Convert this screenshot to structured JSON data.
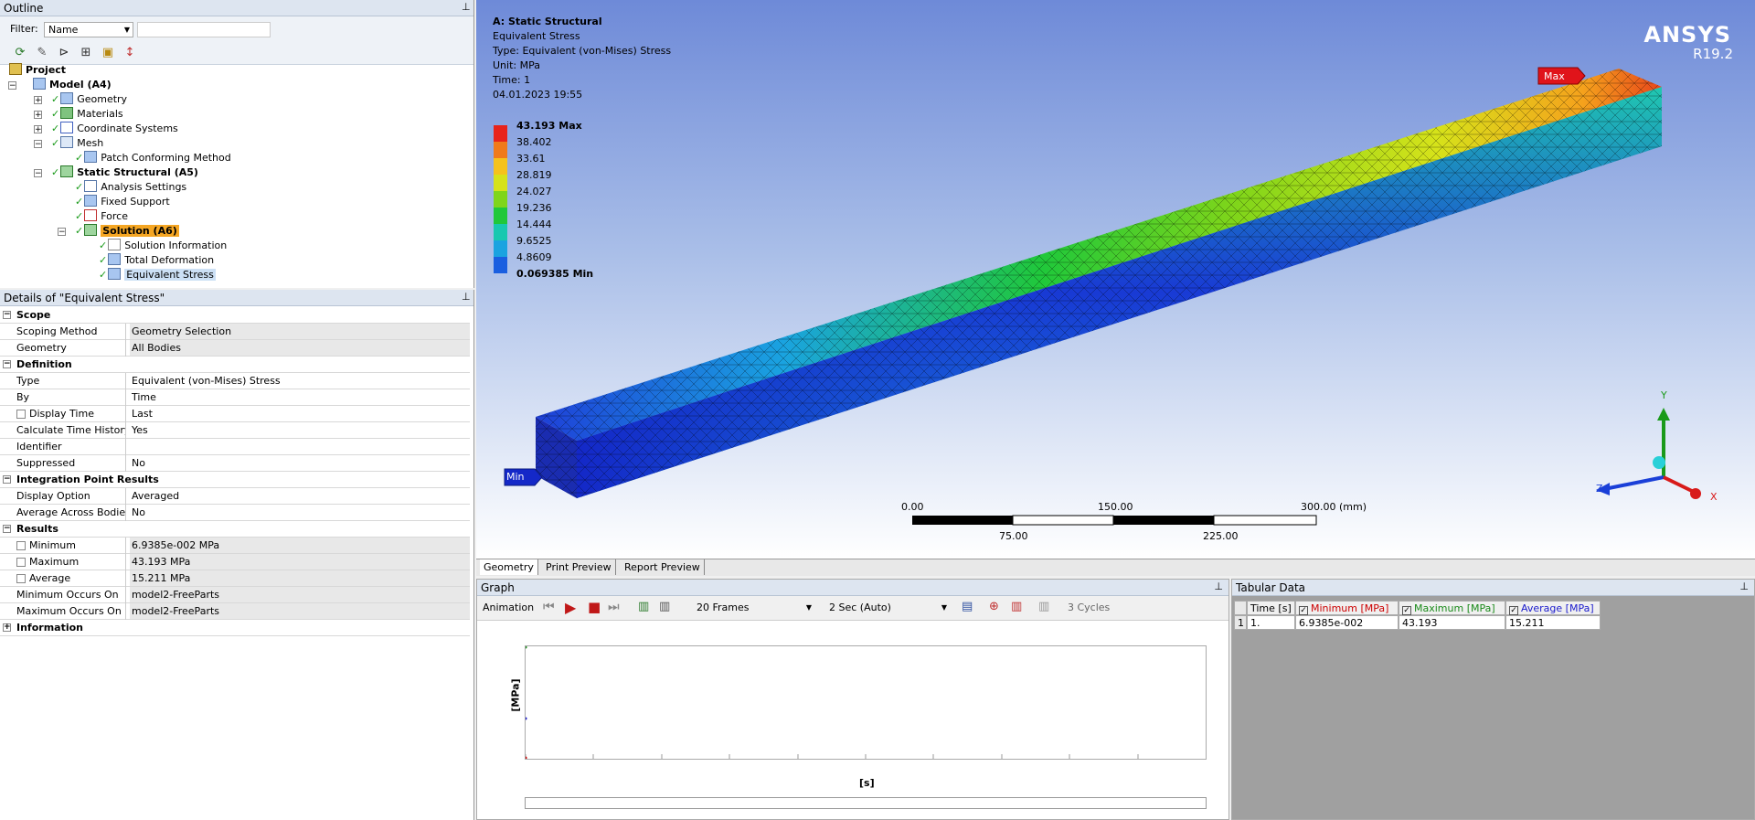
{
  "outline": {
    "title": "Outline",
    "filter_label": "Filter:",
    "filter_value": "Name",
    "tree": [
      {
        "label": "Project",
        "bold": true
      },
      {
        "label": "Model (A4)",
        "bold": true
      },
      {
        "label": "Geometry"
      },
      {
        "label": "Materials"
      },
      {
        "label": "Coordinate Systems"
      },
      {
        "label": "Mesh"
      },
      {
        "label": "Patch Conforming Method"
      },
      {
        "label": "Static Structural (A5)",
        "bold": true
      },
      {
        "label": "Analysis Settings"
      },
      {
        "label": "Fixed Support"
      },
      {
        "label": "Force"
      },
      {
        "label": "Solution (A6)",
        "bold": true
      },
      {
        "label": "Solution Information"
      },
      {
        "label": "Total Deformation"
      },
      {
        "label": "Equivalent Stress"
      }
    ]
  },
  "details": {
    "title": "Details of \"Equivalent Stress\"",
    "rows": [
      {
        "key": "Scope",
        "group": true
      },
      {
        "key": "Scoping Method",
        "value": "Geometry Selection"
      },
      {
        "key": "Geometry",
        "value": "All Bodies"
      },
      {
        "key": "Definition",
        "group": true
      },
      {
        "key": "Type",
        "value": "Equivalent (von-Mises) Stress"
      },
      {
        "key": "By",
        "value": "Time"
      },
      {
        "key": "Display Time",
        "value": "Last"
      },
      {
        "key": "Calculate Time History",
        "value": "Yes"
      },
      {
        "key": "Identifier",
        "value": ""
      },
      {
        "key": "Suppressed",
        "value": "No"
      },
      {
        "key": "Integration Point Results",
        "group": true
      },
      {
        "key": "Display Option",
        "value": "Averaged"
      },
      {
        "key": "Average Across Bodies",
        "value": "No"
      },
      {
        "key": "Results",
        "group": true
      },
      {
        "key": "Minimum",
        "value": "6.9385e-002 MPa"
      },
      {
        "key": "Maximum",
        "value": "43.193 MPa"
      },
      {
        "key": "Average",
        "value": "15.211 MPa"
      },
      {
        "key": "Minimum Occurs On",
        "value": "model2-FreeParts"
      },
      {
        "key": "Maximum Occurs On",
        "value": "model2-FreeParts"
      },
      {
        "key": "Information",
        "group": true
      }
    ]
  },
  "viewport": {
    "header": [
      "A: Static Structural",
      "Equivalent Stress",
      "Type: Equivalent (von-Mises) Stress",
      "Unit: MPa",
      "Time: 1",
      "04.01.2023 19:55"
    ],
    "brand": "ANSYS",
    "version": "R19.2",
    "legend": [
      {
        "label": "43.193 Max",
        "color": "#e8231b",
        "bold": true
      },
      {
        "label": "38.402",
        "color": "#f07a1a"
      },
      {
        "label": "33.61",
        "color": "#f5c21c"
      },
      {
        "label": "28.819",
        "color": "#d6e21a"
      },
      {
        "label": "24.027",
        "color": "#7fd51a"
      },
      {
        "label": "19.236",
        "color": "#20c83a"
      },
      {
        "label": "14.444",
        "color": "#18c8b0"
      },
      {
        "label": "9.6525",
        "color": "#1aa3e0"
      },
      {
        "label": "4.8609",
        "color": "#1a5fe0"
      },
      {
        "label": "0.069385 Min",
        "color": "#1428c8",
        "bold": true
      }
    ],
    "max_tag": "Max",
    "min_tag": "Min",
    "scale_top": [
      "0.00",
      "150.00",
      "300.00 (mm)"
    ],
    "scale_bottom": [
      "75.00",
      "225.00"
    ],
    "axes": {
      "x": "X",
      "y": "Y",
      "z": "Z"
    }
  },
  "tabs": [
    "Geometry",
    "Print Preview",
    "Report Preview"
  ],
  "graph": {
    "title": "Graph",
    "animation_label": "Animation",
    "frames": "20 Frames",
    "duration": "2 Sec (Auto)",
    "cycles": "3 Cycles",
    "ylabel": "[MPa]",
    "xlabel": "[s]"
  },
  "tabular": {
    "title": "Tabular Data",
    "headers": [
      "Time [s]",
      "Minimum [MPa]",
      "Maximum [MPa]",
      "Average [MPa]"
    ],
    "header_colors": [
      "#000000",
      "#cc0000",
      "#1a8a1a",
      "#1a1acc"
    ],
    "rows": [
      [
        "1",
        "1.",
        "6.9385e-002",
        "43.193",
        "15.211"
      ]
    ]
  }
}
